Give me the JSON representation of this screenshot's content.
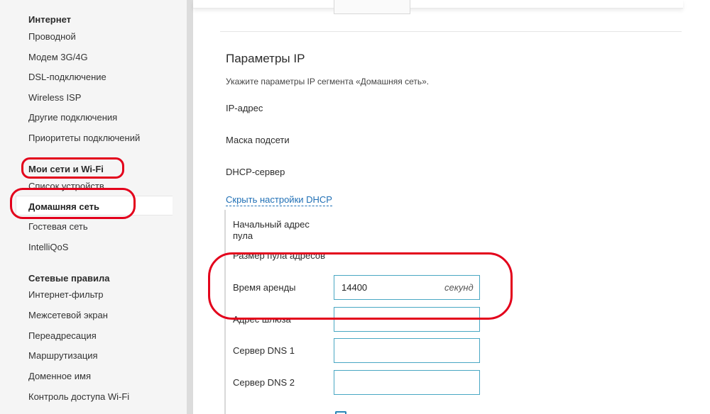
{
  "sidebar": {
    "sections": [
      {
        "title": "Интернет",
        "items": [
          "Проводной",
          "Модем 3G/4G",
          "DSL-подключение",
          "Wireless ISP",
          "Другие подключения",
          "Приоритеты подключений"
        ]
      },
      {
        "title": "Мои сети и Wi-Fi",
        "items": [
          "Список устройств",
          "Домашняя сеть",
          "Гостевая сеть",
          "IntelliQoS"
        ]
      },
      {
        "title": "Сетевые правила",
        "items": [
          "Интернет-фильтр",
          "Межсетевой экран",
          "Переадресация",
          "Маршрутизация",
          "Доменное имя",
          "Контроль доступа Wi-Fi"
        ]
      }
    ],
    "active_item": "Домашняя сеть"
  },
  "main": {
    "section_title": "Параметры IP",
    "section_desc": "Укажите параметры IP сегмента «Домашняя сеть».",
    "fields": {
      "ip_address": "IP-адрес",
      "subnet_mask": "Маска подсети",
      "dhcp_server": "DHCP-сервер"
    },
    "hide_dhcp_link": "Скрыть настройки DHCP",
    "dhcp": {
      "pool_start_label": "Начальный адрес пула",
      "pool_size_label": "Размер пула адресов",
      "lease_time_label": "Время аренды",
      "lease_time_value": "14400",
      "lease_time_unit": "секунд",
      "gateway_label": "Адрес шлюза",
      "gateway_value": "",
      "dns1_label": "Сервер DNS 1",
      "dns1_value": "",
      "dns2_label": "Сервер DNS 2",
      "dns2_value": ""
    }
  },
  "colors": {
    "annotation_red": "#e3001b",
    "input_border": "#49a7c3",
    "link_blue": "#1f6fb5",
    "sidebar_bg": "#f5f5f5"
  }
}
